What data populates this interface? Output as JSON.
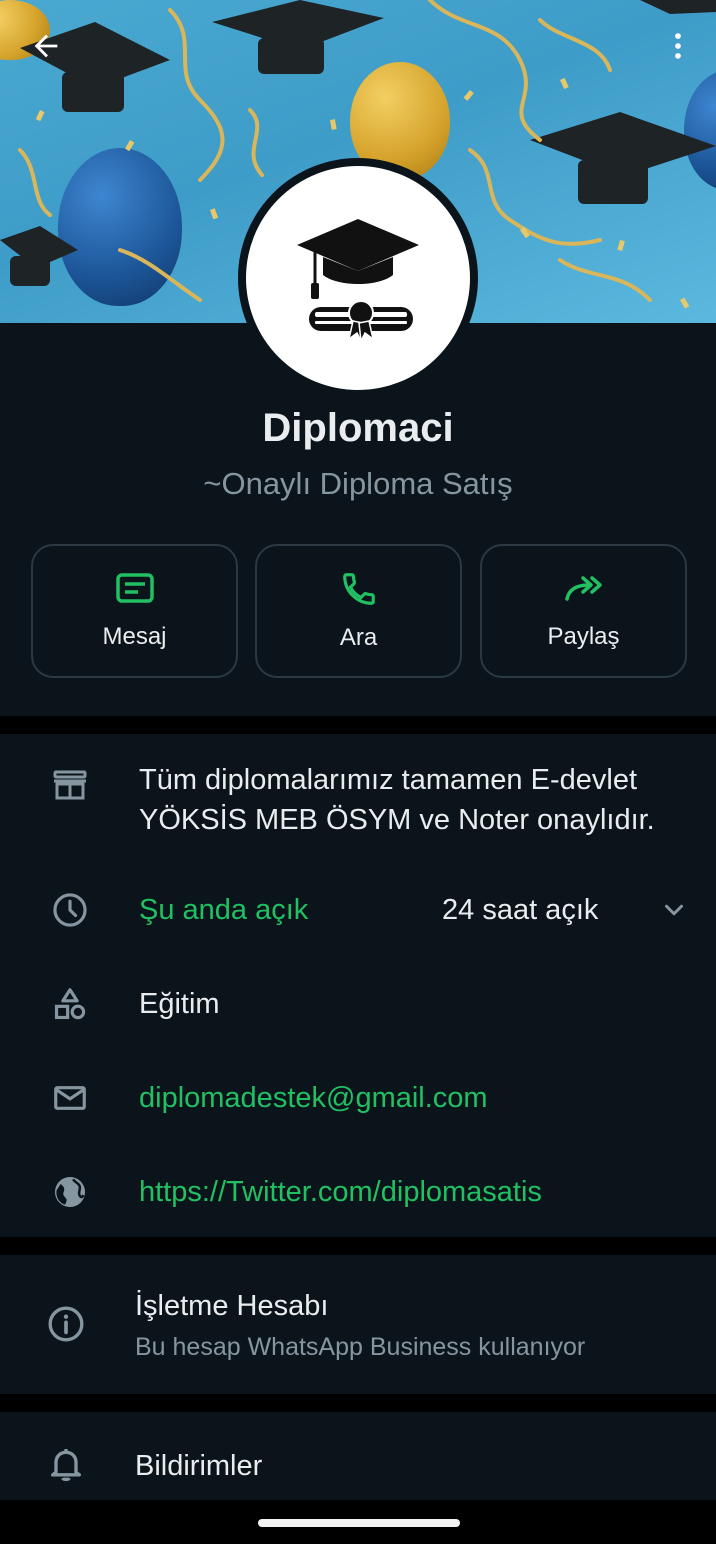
{
  "profile": {
    "name": "Diplomaci",
    "subtitle": "~Onaylı Diploma Satış"
  },
  "actions": [
    {
      "label": "Mesaj",
      "icon": "message-icon"
    },
    {
      "label": "Ara",
      "icon": "phone-icon"
    },
    {
      "label": "Paylaş",
      "icon": "share-icon"
    }
  ],
  "info": {
    "description_line1": "Tüm diplomalarımız tamamen E-devlet",
    "description_line2": "YÖKSİS MEB ÖSYM ve Noter onaylıdır.",
    "hours_status": "Şu anda açık",
    "hours_value": "24 saat açık",
    "category": "Eğitim",
    "email": "diplomadestek@gmail.com",
    "website": "https://Twitter.com/diplomasatis"
  },
  "business": {
    "title": "İşletme Hesabı",
    "subtitle": "Bu hesap WhatsApp Business kullanıyor"
  },
  "notifications": {
    "label": "Bildirimler"
  },
  "colors": {
    "background": "#0b141a",
    "accent_green": "#21c063",
    "text_primary": "#e9edef",
    "text_secondary": "#8696a0"
  }
}
